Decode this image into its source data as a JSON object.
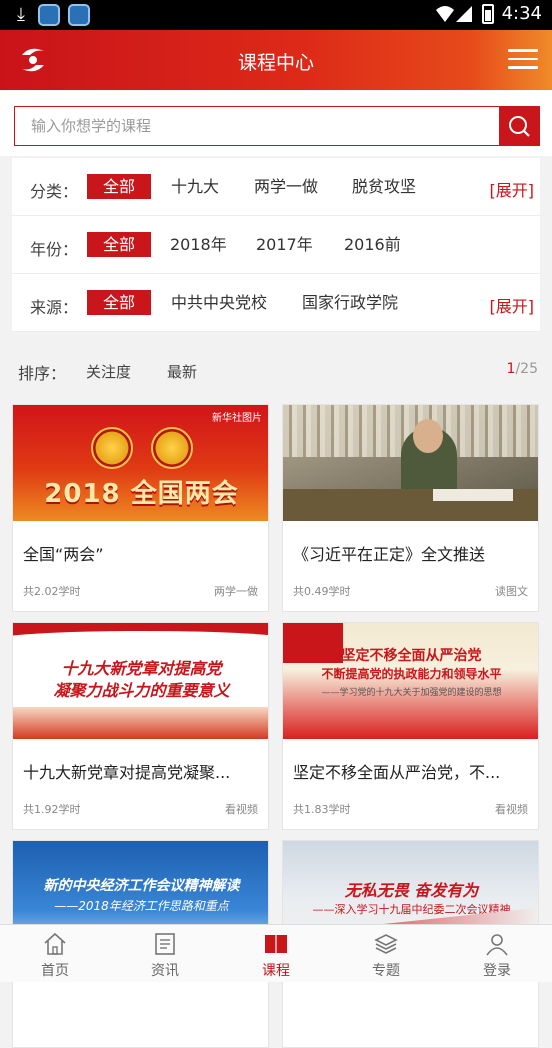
{
  "status_bar": {
    "time": "4:34"
  },
  "header": {
    "title": "课程中心"
  },
  "search": {
    "placeholder": "输入你想学的课程"
  },
  "filters": [
    {
      "label": "分类：",
      "options": [
        "全部",
        "十九大",
        "两学一做",
        "脱贫攻坚"
      ],
      "active": 0,
      "expand": "[展开]"
    },
    {
      "label": "年份：",
      "options": [
        "全部",
        "2018年",
        "2017年",
        "2016前"
      ],
      "active": 0,
      "expand": ""
    },
    {
      "label": "来源：",
      "options": [
        "全部",
        "中共中央党校",
        "国家行政学院"
      ],
      "active": 0,
      "expand": "[展开]"
    }
  ],
  "sort": {
    "label": "排序：",
    "options": [
      "关注度",
      "最新"
    ],
    "page_current": "1",
    "page_total": "/25"
  },
  "courses": [
    {
      "title": "全国“两会”",
      "hours": "共2.02学时",
      "tag": "两学一做",
      "thumb": {
        "line1": "2018 全国两会",
        "badge": "新华社图片"
      }
    },
    {
      "title": "《习近平在正定》全文推送",
      "hours": "共0.49学时",
      "tag": "读图文",
      "thumb": {}
    },
    {
      "title": "十九大新党章对提高党凝聚...",
      "hours": "共1.92学时",
      "tag": "看视频",
      "thumb": {
        "line1": "十九大新党章对提高党",
        "line2": "凝聚力战斗力的重要意义"
      }
    },
    {
      "title": "坚定不移全面从严治党，不...",
      "hours": "共1.83学时",
      "tag": "看视频",
      "thumb": {
        "line1": "坚定不移全面从严治党",
        "line2": "不断提高党的执政能力和领导水平",
        "line3": "——学习党的十九大关于加强党的建设的思想"
      }
    },
    {
      "title": "",
      "hours": "",
      "tag": "",
      "thumb": {
        "line1": "新的中央经济工作会议精神解读",
        "line2": "——2018年经济工作思路和重点"
      }
    },
    {
      "title": "",
      "hours": "",
      "tag": "",
      "thumb": {
        "line1": "无私无畏 奋发有为",
        "line2": "——深入学习十九届中纪委二次会议精神"
      }
    }
  ],
  "bottom_nav": [
    {
      "label": "首页",
      "icon": "home-icon"
    },
    {
      "label": "资讯",
      "icon": "news-icon"
    },
    {
      "label": "课程",
      "icon": "book-icon",
      "active": true
    },
    {
      "label": "专题",
      "icon": "layers-icon"
    },
    {
      "label": "登录",
      "icon": "user-icon"
    }
  ],
  "colors": {
    "brand_red": "#c9161b",
    "header_gradient_end": "#f08a2a"
  }
}
